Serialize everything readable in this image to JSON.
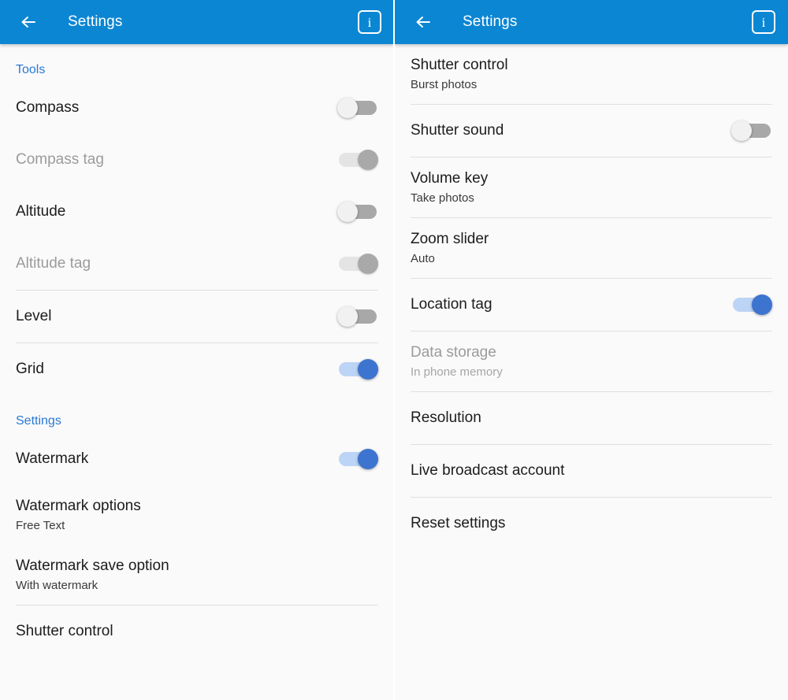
{
  "panels": [
    {
      "appbar": {
        "back_icon": "arrow-left-icon",
        "title": "Settings",
        "info_icon": "info-icon",
        "info_glyph": "i",
        "background": "#0b86d3"
      },
      "groups": [
        {
          "header": "Tools",
          "rows": [
            {
              "title": "Compass",
              "sub": null,
              "control": "toggle",
              "state": "off",
              "disabled": false,
              "divider_after": false
            },
            {
              "title": "Compass tag",
              "sub": null,
              "control": "toggle",
              "state": "on-disabled",
              "disabled": true,
              "divider_after": false
            },
            {
              "title": "Altitude",
              "sub": null,
              "control": "toggle",
              "state": "off",
              "disabled": false,
              "divider_after": false
            },
            {
              "title": "Altitude tag",
              "sub": null,
              "control": "toggle",
              "state": "on-disabled",
              "disabled": true,
              "divider_after": true
            },
            {
              "title": "Level",
              "sub": null,
              "control": "toggle",
              "state": "off",
              "disabled": false,
              "divider_after": true
            },
            {
              "title": "Grid",
              "sub": null,
              "control": "toggle",
              "state": "on",
              "disabled": false,
              "divider_after": false
            }
          ]
        },
        {
          "header": "Settings",
          "rows": [
            {
              "title": "Watermark",
              "sub": null,
              "control": "toggle",
              "state": "on",
              "disabled": false,
              "divider_after": false
            },
            {
              "title": "Watermark options",
              "sub": "Free Text",
              "control": "none",
              "state": null,
              "disabled": false,
              "divider_after": false
            },
            {
              "title": "Watermark save option",
              "sub": "With watermark",
              "control": "none",
              "state": null,
              "disabled": false,
              "divider_after": true
            },
            {
              "title": "Shutter control",
              "sub": null,
              "control": "none",
              "state": null,
              "disabled": false,
              "divider_after": false
            }
          ]
        }
      ]
    },
    {
      "appbar": {
        "back_icon": "arrow-left-icon",
        "title": "Settings",
        "info_icon": "info-icon",
        "info_glyph": "i",
        "background": "#0b86d3"
      },
      "groups": [
        {
          "header": null,
          "rows": [
            {
              "title": "Shutter control",
              "sub": "Burst photos",
              "control": "none",
              "state": null,
              "disabled": false,
              "divider_after": true
            },
            {
              "title": "Shutter sound",
              "sub": null,
              "control": "toggle",
              "state": "off",
              "disabled": false,
              "divider_after": true
            },
            {
              "title": "Volume key",
              "sub": "Take photos",
              "control": "none",
              "state": null,
              "disabled": false,
              "divider_after": true
            },
            {
              "title": "Zoom slider",
              "sub": "Auto",
              "control": "none",
              "state": null,
              "disabled": false,
              "divider_after": true
            },
            {
              "title": "Location tag",
              "sub": null,
              "control": "toggle",
              "state": "on",
              "disabled": false,
              "divider_after": true
            },
            {
              "title": "Data storage",
              "sub": "In phone memory",
              "control": "none",
              "state": null,
              "disabled": true,
              "divider_after": true
            },
            {
              "title": "Resolution",
              "sub": null,
              "control": "none",
              "state": null,
              "disabled": false,
              "divider_after": true
            },
            {
              "title": "Live broadcast account",
              "sub": null,
              "control": "none",
              "state": null,
              "disabled": false,
              "divider_after": true
            },
            {
              "title": "Reset settings",
              "sub": null,
              "control": "none",
              "state": null,
              "disabled": false,
              "divider_after": false
            }
          ]
        }
      ]
    }
  ],
  "colors": {
    "appbar": "#0b86d3",
    "section_header": "#2a79d6",
    "toggle_on": "#3d74d0",
    "toggle_on_track": "#bcd4f5",
    "toggle_off_track": "#a8a8a8",
    "background": "#fafafa",
    "divider": "#e0e0e0"
  }
}
